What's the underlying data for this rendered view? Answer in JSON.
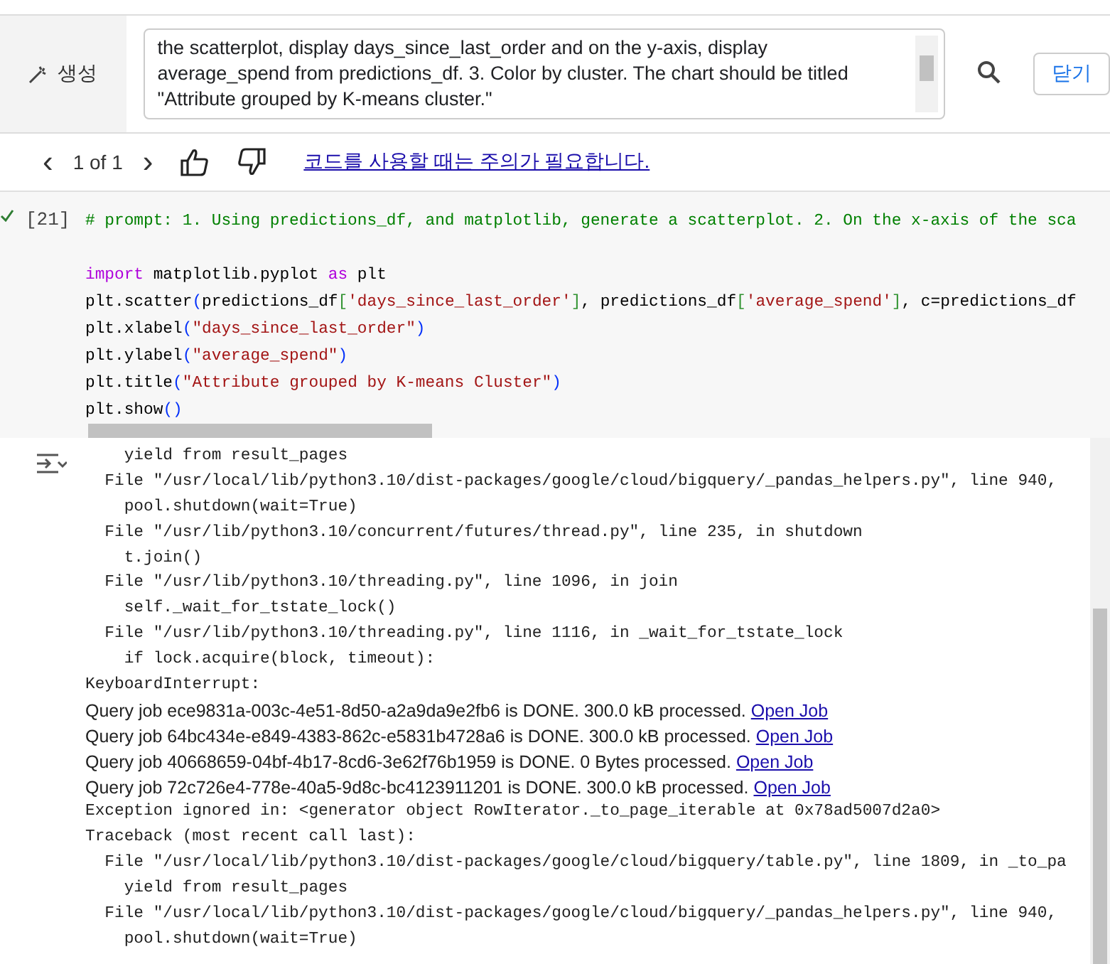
{
  "generate_bar": {
    "label": "생성",
    "prompt": "the scatterplot, display days_since_last_order and on the y-axis, display average_spend from predictions_df. 3. Color by cluster. The chart should be titled \"Attribute grouped by K-means cluster.\"",
    "close_button": "닫기"
  },
  "pager": {
    "prev": "‹",
    "count": "1 of 1",
    "next": "›",
    "notice_link": "코드를 사용할 때는 주의가 필요합니다."
  },
  "code_cell": {
    "execution_count": "[21]",
    "run_succeeded": true,
    "lines": [
      [
        {
          "kind": "comment",
          "text": "# prompt: 1. Using predictions_df, and matplotlib, generate a scatterplot. 2. On the x-axis of the sca"
        }
      ],
      [
        {
          "kind": "blank"
        }
      ],
      [
        {
          "kind": "keyword",
          "text": "import"
        },
        {
          "kind": "plain",
          "text": " matplotlib.pyplot "
        },
        {
          "kind": "keyword",
          "text": "as"
        },
        {
          "kind": "plain",
          "text": " plt"
        }
      ],
      [
        {
          "kind": "plain",
          "text": "plt.scatter"
        },
        {
          "kind": "paren",
          "text": "("
        },
        {
          "kind": "plain",
          "text": "predictions_df"
        },
        {
          "kind": "bracket",
          "text": "["
        },
        {
          "kind": "string",
          "text": "'days_since_last_order'"
        },
        {
          "kind": "bracket",
          "text": "]"
        },
        {
          "kind": "plain",
          "text": ", predictions_df"
        },
        {
          "kind": "bracket",
          "text": "["
        },
        {
          "kind": "string",
          "text": "'average_spend'"
        },
        {
          "kind": "bracket",
          "text": "]"
        },
        {
          "kind": "plain",
          "text": ", c=predictions_df"
        }
      ],
      [
        {
          "kind": "plain",
          "text": "plt.xlabel"
        },
        {
          "kind": "paren",
          "text": "("
        },
        {
          "kind": "string",
          "text": "\"days_since_last_order\""
        },
        {
          "kind": "paren",
          "text": ")"
        }
      ],
      [
        {
          "kind": "plain",
          "text": "plt.ylabel"
        },
        {
          "kind": "paren",
          "text": "("
        },
        {
          "kind": "string",
          "text": "\"average_spend\""
        },
        {
          "kind": "paren",
          "text": ")"
        }
      ],
      [
        {
          "kind": "plain",
          "text": "plt.title"
        },
        {
          "kind": "paren",
          "text": "("
        },
        {
          "kind": "string",
          "text": "\"Attribute grouped by K-means Cluster\""
        },
        {
          "kind": "paren",
          "text": ")"
        }
      ],
      [
        {
          "kind": "plain",
          "text": "plt.show"
        },
        {
          "kind": "paren",
          "text": "()"
        }
      ]
    ]
  },
  "output": [
    {
      "kind": "line",
      "text": "    yield from result_pages"
    },
    {
      "kind": "line",
      "text": "  File \"/usr/local/lib/python3.10/dist-packages/google/cloud/bigquery/_pandas_helpers.py\", line 940,"
    },
    {
      "kind": "line",
      "text": "    pool.shutdown(wait=True)"
    },
    {
      "kind": "line",
      "text": "  File \"/usr/lib/python3.10/concurrent/futures/thread.py\", line 235, in shutdown"
    },
    {
      "kind": "line",
      "text": "    t.join()"
    },
    {
      "kind": "line",
      "text": "  File \"/usr/lib/python3.10/threading.py\", line 1096, in join"
    },
    {
      "kind": "line",
      "text": "    self._wait_for_tstate_lock()"
    },
    {
      "kind": "line",
      "text": "  File \"/usr/lib/python3.10/threading.py\", line 1116, in _wait_for_tstate_lock"
    },
    {
      "kind": "line",
      "text": "    if lock.acquire(block, timeout):"
    },
    {
      "kind": "line",
      "text": "KeyboardInterrupt:"
    },
    {
      "kind": "job",
      "text": "Query job ece9831a-003c-4e51-8d50-a2a9da9e2fb6 is DONE. 300.0 kB processed.",
      "link": "Open Job"
    },
    {
      "kind": "job",
      "text": "Query job 64bc434e-e849-4383-862c-e5831b4728a6 is DONE. 300.0 kB processed.",
      "link": "Open Job"
    },
    {
      "kind": "job",
      "text": "Query job 40668659-04bf-4b17-8cd6-3e62f76b1959 is DONE. 0 Bytes processed.",
      "link": "Open Job"
    },
    {
      "kind": "job",
      "text": "Query job 72c726e4-778e-40a5-9d8c-bc4123911201 is DONE. 300.0 kB processed.",
      "link": "Open Job"
    },
    {
      "kind": "line",
      "text": "Exception ignored in: <generator object RowIterator._to_page_iterable at 0x78ad5007d2a0>"
    },
    {
      "kind": "line",
      "text": "Traceback (most recent call last):"
    },
    {
      "kind": "line",
      "text": "  File \"/usr/local/lib/python3.10/dist-packages/google/cloud/bigquery/table.py\", line 1809, in _to_pa"
    },
    {
      "kind": "line",
      "text": "    yield from result_pages"
    },
    {
      "kind": "line",
      "text": "  File \"/usr/local/lib/python3.10/dist-packages/google/cloud/bigquery/_pandas_helpers.py\", line 940,"
    },
    {
      "kind": "line",
      "text": "    pool.shutdown(wait=True)"
    }
  ]
}
